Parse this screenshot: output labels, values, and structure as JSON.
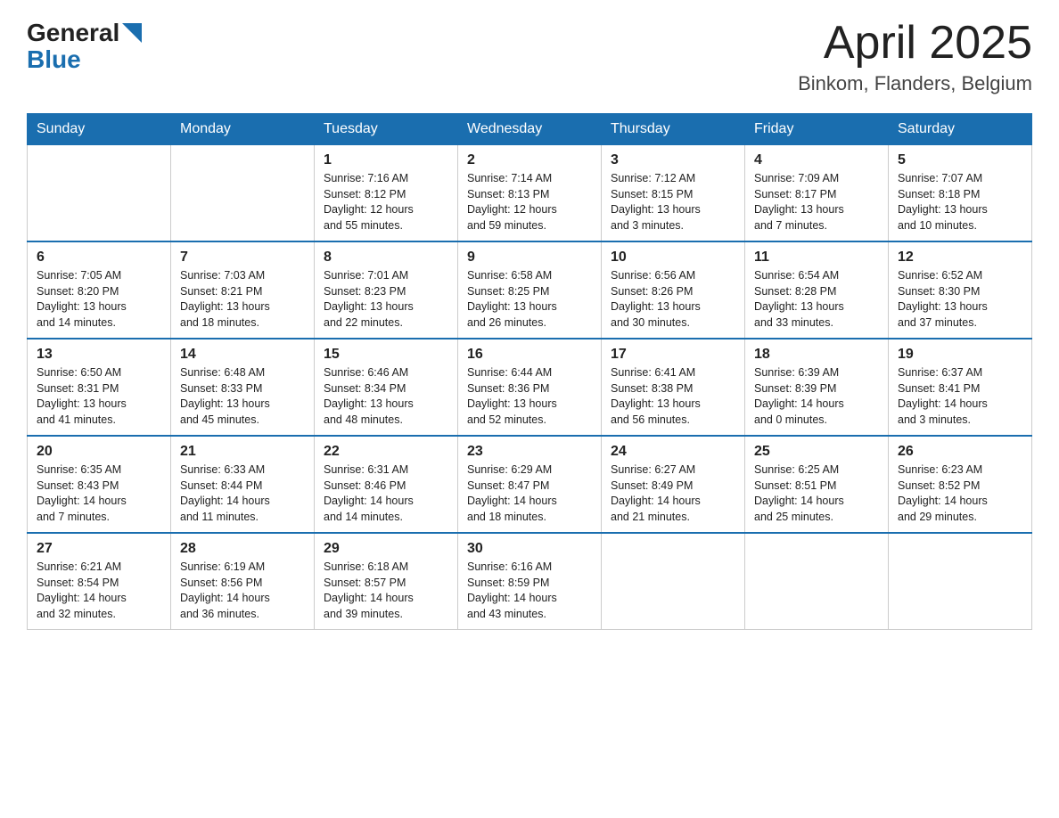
{
  "header": {
    "logo_general": "General",
    "logo_blue": "Blue",
    "title": "April 2025",
    "subtitle": "Binkom, Flanders, Belgium"
  },
  "calendar": {
    "days_of_week": [
      "Sunday",
      "Monday",
      "Tuesday",
      "Wednesday",
      "Thursday",
      "Friday",
      "Saturday"
    ],
    "weeks": [
      [
        {
          "day": "",
          "info": ""
        },
        {
          "day": "",
          "info": ""
        },
        {
          "day": "1",
          "info": "Sunrise: 7:16 AM\nSunset: 8:12 PM\nDaylight: 12 hours\nand 55 minutes."
        },
        {
          "day": "2",
          "info": "Sunrise: 7:14 AM\nSunset: 8:13 PM\nDaylight: 12 hours\nand 59 minutes."
        },
        {
          "day": "3",
          "info": "Sunrise: 7:12 AM\nSunset: 8:15 PM\nDaylight: 13 hours\nand 3 minutes."
        },
        {
          "day": "4",
          "info": "Sunrise: 7:09 AM\nSunset: 8:17 PM\nDaylight: 13 hours\nand 7 minutes."
        },
        {
          "day": "5",
          "info": "Sunrise: 7:07 AM\nSunset: 8:18 PM\nDaylight: 13 hours\nand 10 minutes."
        }
      ],
      [
        {
          "day": "6",
          "info": "Sunrise: 7:05 AM\nSunset: 8:20 PM\nDaylight: 13 hours\nand 14 minutes."
        },
        {
          "day": "7",
          "info": "Sunrise: 7:03 AM\nSunset: 8:21 PM\nDaylight: 13 hours\nand 18 minutes."
        },
        {
          "day": "8",
          "info": "Sunrise: 7:01 AM\nSunset: 8:23 PM\nDaylight: 13 hours\nand 22 minutes."
        },
        {
          "day": "9",
          "info": "Sunrise: 6:58 AM\nSunset: 8:25 PM\nDaylight: 13 hours\nand 26 minutes."
        },
        {
          "day": "10",
          "info": "Sunrise: 6:56 AM\nSunset: 8:26 PM\nDaylight: 13 hours\nand 30 minutes."
        },
        {
          "day": "11",
          "info": "Sunrise: 6:54 AM\nSunset: 8:28 PM\nDaylight: 13 hours\nand 33 minutes."
        },
        {
          "day": "12",
          "info": "Sunrise: 6:52 AM\nSunset: 8:30 PM\nDaylight: 13 hours\nand 37 minutes."
        }
      ],
      [
        {
          "day": "13",
          "info": "Sunrise: 6:50 AM\nSunset: 8:31 PM\nDaylight: 13 hours\nand 41 minutes."
        },
        {
          "day": "14",
          "info": "Sunrise: 6:48 AM\nSunset: 8:33 PM\nDaylight: 13 hours\nand 45 minutes."
        },
        {
          "day": "15",
          "info": "Sunrise: 6:46 AM\nSunset: 8:34 PM\nDaylight: 13 hours\nand 48 minutes."
        },
        {
          "day": "16",
          "info": "Sunrise: 6:44 AM\nSunset: 8:36 PM\nDaylight: 13 hours\nand 52 minutes."
        },
        {
          "day": "17",
          "info": "Sunrise: 6:41 AM\nSunset: 8:38 PM\nDaylight: 13 hours\nand 56 minutes."
        },
        {
          "day": "18",
          "info": "Sunrise: 6:39 AM\nSunset: 8:39 PM\nDaylight: 14 hours\nand 0 minutes."
        },
        {
          "day": "19",
          "info": "Sunrise: 6:37 AM\nSunset: 8:41 PM\nDaylight: 14 hours\nand 3 minutes."
        }
      ],
      [
        {
          "day": "20",
          "info": "Sunrise: 6:35 AM\nSunset: 8:43 PM\nDaylight: 14 hours\nand 7 minutes."
        },
        {
          "day": "21",
          "info": "Sunrise: 6:33 AM\nSunset: 8:44 PM\nDaylight: 14 hours\nand 11 minutes."
        },
        {
          "day": "22",
          "info": "Sunrise: 6:31 AM\nSunset: 8:46 PM\nDaylight: 14 hours\nand 14 minutes."
        },
        {
          "day": "23",
          "info": "Sunrise: 6:29 AM\nSunset: 8:47 PM\nDaylight: 14 hours\nand 18 minutes."
        },
        {
          "day": "24",
          "info": "Sunrise: 6:27 AM\nSunset: 8:49 PM\nDaylight: 14 hours\nand 21 minutes."
        },
        {
          "day": "25",
          "info": "Sunrise: 6:25 AM\nSunset: 8:51 PM\nDaylight: 14 hours\nand 25 minutes."
        },
        {
          "day": "26",
          "info": "Sunrise: 6:23 AM\nSunset: 8:52 PM\nDaylight: 14 hours\nand 29 minutes."
        }
      ],
      [
        {
          "day": "27",
          "info": "Sunrise: 6:21 AM\nSunset: 8:54 PM\nDaylight: 14 hours\nand 32 minutes."
        },
        {
          "day": "28",
          "info": "Sunrise: 6:19 AM\nSunset: 8:56 PM\nDaylight: 14 hours\nand 36 minutes."
        },
        {
          "day": "29",
          "info": "Sunrise: 6:18 AM\nSunset: 8:57 PM\nDaylight: 14 hours\nand 39 minutes."
        },
        {
          "day": "30",
          "info": "Sunrise: 6:16 AM\nSunset: 8:59 PM\nDaylight: 14 hours\nand 43 minutes."
        },
        {
          "day": "",
          "info": ""
        },
        {
          "day": "",
          "info": ""
        },
        {
          "day": "",
          "info": ""
        }
      ]
    ]
  }
}
